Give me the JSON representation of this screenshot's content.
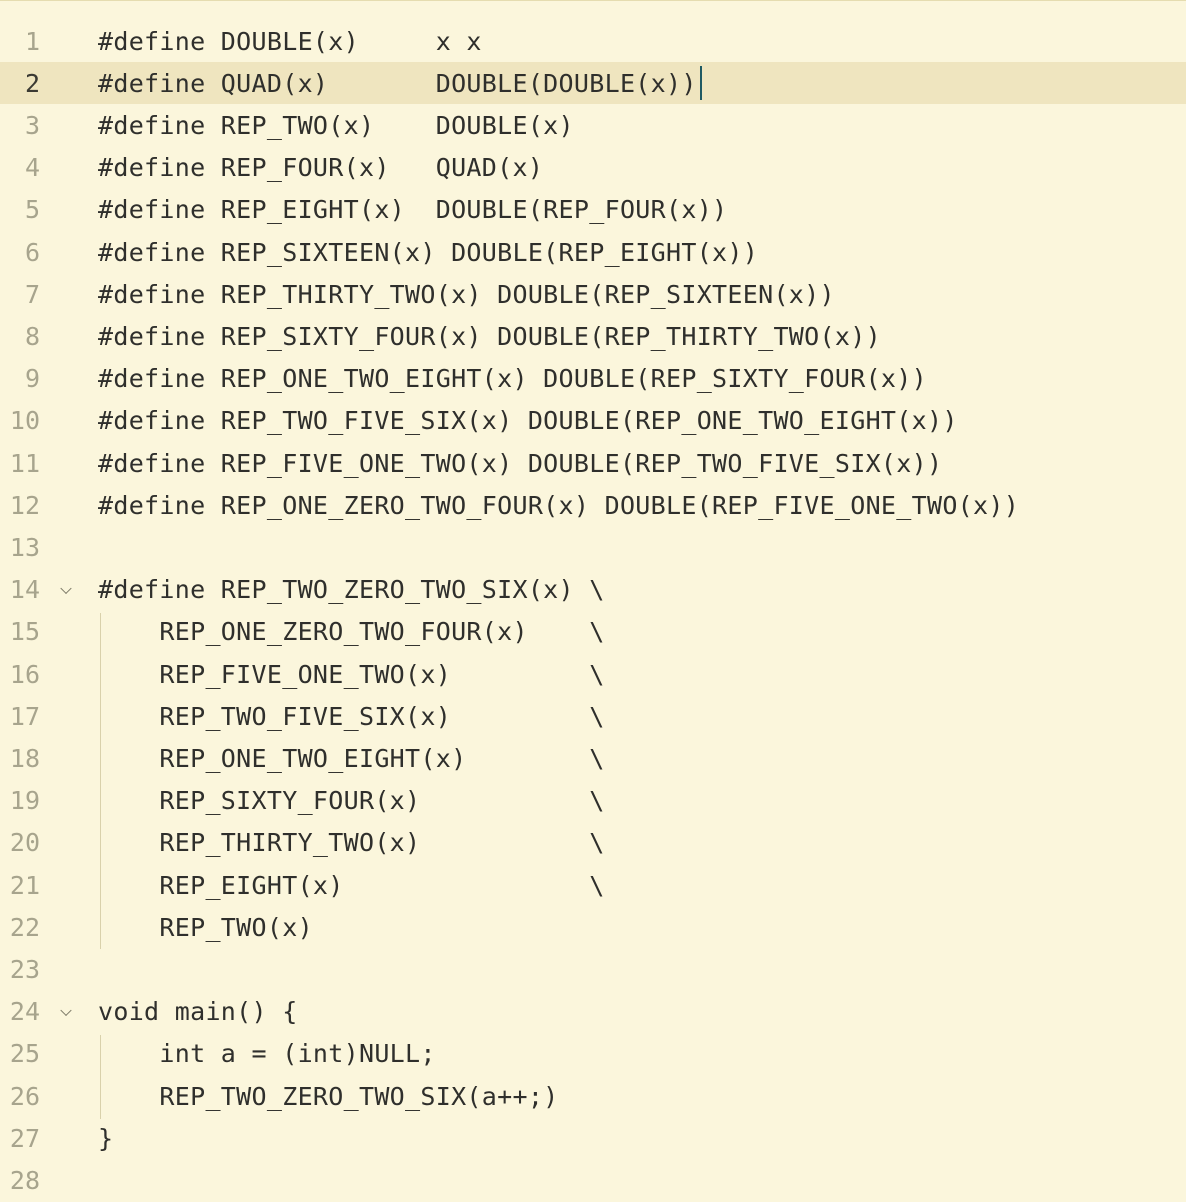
{
  "editor": {
    "current_line": 2,
    "lines": [
      {
        "num": "1",
        "text": "#define DOUBLE(x)     x x",
        "fold": false
      },
      {
        "num": "2",
        "text": "#define QUAD(x)       DOUBLE(DOUBLE(x))",
        "fold": false
      },
      {
        "num": "3",
        "text": "#define REP_TWO(x)    DOUBLE(x)",
        "fold": false
      },
      {
        "num": "4",
        "text": "#define REP_FOUR(x)   QUAD(x)",
        "fold": false
      },
      {
        "num": "5",
        "text": "#define REP_EIGHT(x)  DOUBLE(REP_FOUR(x))",
        "fold": false
      },
      {
        "num": "6",
        "text": "#define REP_SIXTEEN(x) DOUBLE(REP_EIGHT(x))",
        "fold": false
      },
      {
        "num": "7",
        "text": "#define REP_THIRTY_TWO(x) DOUBLE(REP_SIXTEEN(x))",
        "fold": false
      },
      {
        "num": "8",
        "text": "#define REP_SIXTY_FOUR(x) DOUBLE(REP_THIRTY_TWO(x))",
        "fold": false
      },
      {
        "num": "9",
        "text": "#define REP_ONE_TWO_EIGHT(x) DOUBLE(REP_SIXTY_FOUR(x))",
        "fold": false
      },
      {
        "num": "10",
        "text": "#define REP_TWO_FIVE_SIX(x) DOUBLE(REP_ONE_TWO_EIGHT(x))",
        "fold": false
      },
      {
        "num": "11",
        "text": "#define REP_FIVE_ONE_TWO(x) DOUBLE(REP_TWO_FIVE_SIX(x))",
        "fold": false
      },
      {
        "num": "12",
        "text": "#define REP_ONE_ZERO_TWO_FOUR(x) DOUBLE(REP_FIVE_ONE_TWO(x))",
        "fold": false
      },
      {
        "num": "13",
        "text": "",
        "fold": false
      },
      {
        "num": "14",
        "text": "#define REP_TWO_ZERO_TWO_SIX(x) \\",
        "fold": true
      },
      {
        "num": "15",
        "text": "    REP_ONE_ZERO_TWO_FOUR(x)    \\",
        "fold": false
      },
      {
        "num": "16",
        "text": "    REP_FIVE_ONE_TWO(x)         \\",
        "fold": false
      },
      {
        "num": "17",
        "text": "    REP_TWO_FIVE_SIX(x)         \\",
        "fold": false
      },
      {
        "num": "18",
        "text": "    REP_ONE_TWO_EIGHT(x)        \\",
        "fold": false
      },
      {
        "num": "19",
        "text": "    REP_SIXTY_FOUR(x)           \\",
        "fold": false
      },
      {
        "num": "20",
        "text": "    REP_THIRTY_TWO(x)           \\",
        "fold": false
      },
      {
        "num": "21",
        "text": "    REP_EIGHT(x)                \\",
        "fold": false
      },
      {
        "num": "22",
        "text": "    REP_TWO(x)",
        "fold": false
      },
      {
        "num": "23",
        "text": "",
        "fold": false
      },
      {
        "num": "24",
        "text": "void main() {",
        "fold": true
      },
      {
        "num": "25",
        "text": "    int a = (int)NULL;",
        "fold": false
      },
      {
        "num": "26",
        "text": "    REP_TWO_ZERO_TWO_SIX(a++;)",
        "fold": false
      },
      {
        "num": "27",
        "text": "}",
        "fold": false
      },
      {
        "num": "28",
        "text": "",
        "fold": false
      }
    ]
  }
}
